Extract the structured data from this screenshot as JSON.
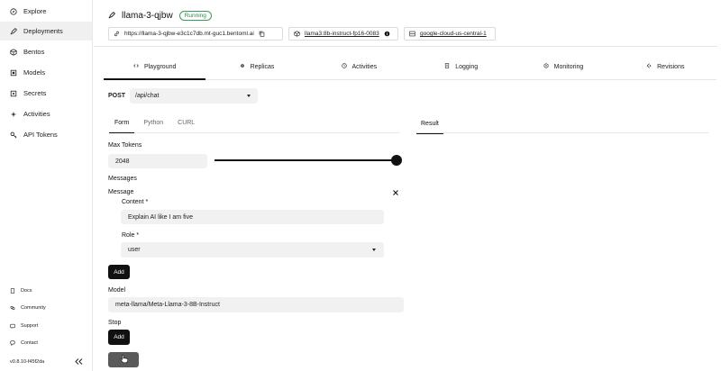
{
  "sidebar": {
    "items": [
      {
        "label": "Explore",
        "icon": "compass-icon",
        "active": false
      },
      {
        "label": "Deployments",
        "icon": "rocket-icon",
        "active": true
      },
      {
        "label": "Bentos",
        "icon": "box-icon",
        "active": false
      },
      {
        "label": "Models",
        "icon": "cube-icon",
        "active": false
      },
      {
        "label": "Secrets",
        "icon": "secret-icon",
        "active": false
      },
      {
        "label": "Activities",
        "icon": "activity-icon",
        "active": false
      },
      {
        "label": "API Tokens",
        "icon": "key-icon",
        "active": false
      }
    ],
    "footer": [
      {
        "label": "Docs",
        "icon": "docs-icon"
      },
      {
        "label": "Community",
        "icon": "community-icon"
      },
      {
        "label": "Support",
        "icon": "support-icon"
      },
      {
        "label": "Contact",
        "icon": "contact-icon"
      }
    ],
    "version": "v0.8.10-f45f2da"
  },
  "header": {
    "title": "llama-3-qjbw",
    "status": "Running",
    "url": "https://llama-3-qjbw-e3c1c7db.mt-guc1.bentoml.ai",
    "bento": "llama3:8b-instruct-fp16-0083",
    "cluster": "google-cloud-us-central-1"
  },
  "tabs": [
    {
      "label": "Playground",
      "icon": "code-icon",
      "active": true
    },
    {
      "label": "Replicas",
      "icon": "replicas-icon",
      "active": false
    },
    {
      "label": "Activities",
      "icon": "activity-icon",
      "active": false
    },
    {
      "label": "Logging",
      "icon": "logging-icon",
      "active": false
    },
    {
      "label": "Monitoring",
      "icon": "monitoring-icon",
      "active": false
    },
    {
      "label": "Revisions",
      "icon": "revisions-icon",
      "active": false
    }
  ],
  "request": {
    "method": "POST",
    "endpoint": "/api/chat"
  },
  "subtabs": [
    {
      "label": "Form",
      "active": true
    },
    {
      "label": "Python",
      "active": false
    },
    {
      "label": "CURL",
      "active": false
    }
  ],
  "result_label": "Result",
  "form": {
    "max_tokens_label": "Max Tokens",
    "max_tokens_value": "2048",
    "max_tokens_slider_fraction": 1.0,
    "messages_label": "Messages",
    "message_label": "Message",
    "content_label": "Content *",
    "content_value": "Explain AI like I am five",
    "role_label": "Role *",
    "role_value": "user",
    "add_label": "Add",
    "model_label": "Model",
    "model_value": "meta-llama/Meta-Llama-3-8B-Instruct",
    "stop_label": "Stop",
    "stop_add_label": "Add"
  },
  "colors": {
    "accent": "#111111",
    "running": "#2f8a4c",
    "field_bg": "#f1f1f1",
    "submit_bg": "#5a5a5a"
  }
}
